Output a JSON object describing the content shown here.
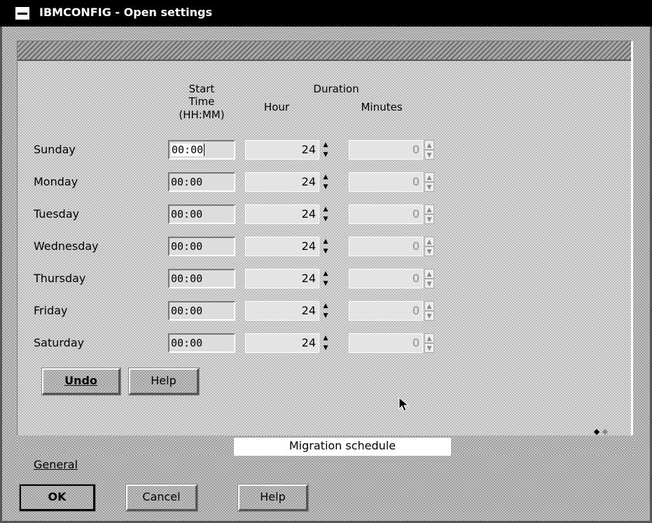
{
  "window": {
    "title": "IBMCONFIG - Open settings"
  },
  "schedule": {
    "headers": {
      "start": "Start",
      "time": "Time",
      "format": "(HH:MM)",
      "duration": "Duration",
      "hour": "Hour",
      "minutes": "Minutes"
    },
    "days": [
      {
        "name": "Sunday",
        "start": "00:00",
        "hour": "24",
        "minutes": "0"
      },
      {
        "name": "Monday",
        "start": "00:00",
        "hour": "24",
        "minutes": "0"
      },
      {
        "name": "Tuesday",
        "start": "00:00",
        "hour": "24",
        "minutes": "0"
      },
      {
        "name": "Wednesday",
        "start": "00:00",
        "hour": "24",
        "minutes": "0"
      },
      {
        "name": "Thursday",
        "start": "00:00",
        "hour": "24",
        "minutes": "0"
      },
      {
        "name": "Friday",
        "start": "00:00",
        "hour": "24",
        "minutes": "0"
      },
      {
        "name": "Saturday",
        "start": "00:00",
        "hour": "24",
        "minutes": "0"
      }
    ]
  },
  "page_buttons": {
    "undo": "Undo",
    "help": "Help"
  },
  "tabs": {
    "migration": "Migration schedule",
    "general": "General"
  },
  "dialog_buttons": {
    "ok": "OK",
    "cancel": "Cancel",
    "help": "Help"
  },
  "icons": {
    "system_menu": "system-menu-icon",
    "spin_up": "up-arrow-icon",
    "spin_down": "down-arrow-icon",
    "mouse_pointer": "mouse-pointer-icon"
  }
}
